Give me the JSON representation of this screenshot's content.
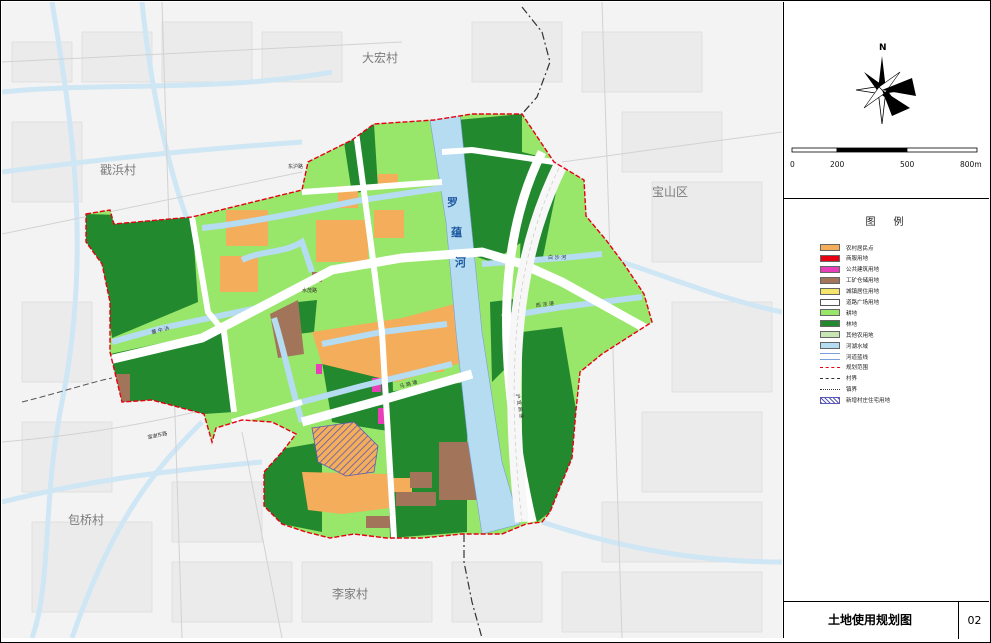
{
  "map": {
    "places": [
      {
        "id": "dahong",
        "name": "大宏村"
      },
      {
        "id": "zhanbin",
        "name": "戳浜村"
      },
      {
        "id": "baoshan",
        "name": "宝山区"
      },
      {
        "id": "baoqiao",
        "name": "包桥村"
      },
      {
        "id": "lijia",
        "name": "李家村"
      }
    ],
    "river": {
      "name_chars": [
        "罗",
        "蕴",
        "河"
      ]
    },
    "roads": [
      {
        "id": "dongliu",
        "name": "东沪路"
      },
      {
        "id": "shuichan",
        "name": "水茂路"
      },
      {
        "id": "fuyuan",
        "name": "富谢东路"
      },
      {
        "id": "huyi",
        "name": "沪 宜 高 速"
      },
      {
        "id": "malu",
        "name": "马 路 塘"
      },
      {
        "id": "baisha",
        "name": "白 沙 河"
      },
      {
        "id": "xijing",
        "name": "西 泾 港"
      },
      {
        "id": "dongtang",
        "name": "董 中 浜"
      }
    ]
  },
  "north": {
    "label": "N"
  },
  "scale": {
    "labels": [
      "0",
      "200",
      "500",
      "800m"
    ]
  },
  "legend": {
    "title": "图　例",
    "items": [
      {
        "label": "农村居民点",
        "color": "#f4ad5a",
        "style": "fill"
      },
      {
        "label": "商服用地",
        "color": "#e60012",
        "style": "fill"
      },
      {
        "label": "公共建筑用地",
        "color": "#e83fb8",
        "style": "fill"
      },
      {
        "label": "工矿仓储用地",
        "color": "#a2755a",
        "style": "fill"
      },
      {
        "label": "城镇居住用地",
        "color": "#f5e56a",
        "style": "fill"
      },
      {
        "label": "道路广场用地",
        "color": "#ffffff",
        "style": "outline"
      },
      {
        "label": "耕地",
        "color": "#98e66a",
        "style": "fill"
      },
      {
        "label": "林地",
        "color": "#22892f",
        "style": "fill"
      },
      {
        "label": "其他农用地",
        "color": "#c8e6b4",
        "style": "fill"
      },
      {
        "label": "河湖水域",
        "color": "#b6dcf2",
        "style": "fill"
      },
      {
        "label": "河道蓝线",
        "color": "#7a9fd8",
        "style": "double-line"
      },
      {
        "label": "规划范围",
        "color": "#e60012",
        "style": "dash-red"
      },
      {
        "label": "村界",
        "color": "#333333",
        "style": "dash"
      },
      {
        "label": "镇界",
        "color": "#333333",
        "style": "dashdot"
      },
      {
        "label": "新增村庄住宅用地",
        "color": "#5a5ab4",
        "style": "hatch"
      }
    ]
  },
  "title": {
    "text": "土地使用规划图",
    "number": "02"
  }
}
